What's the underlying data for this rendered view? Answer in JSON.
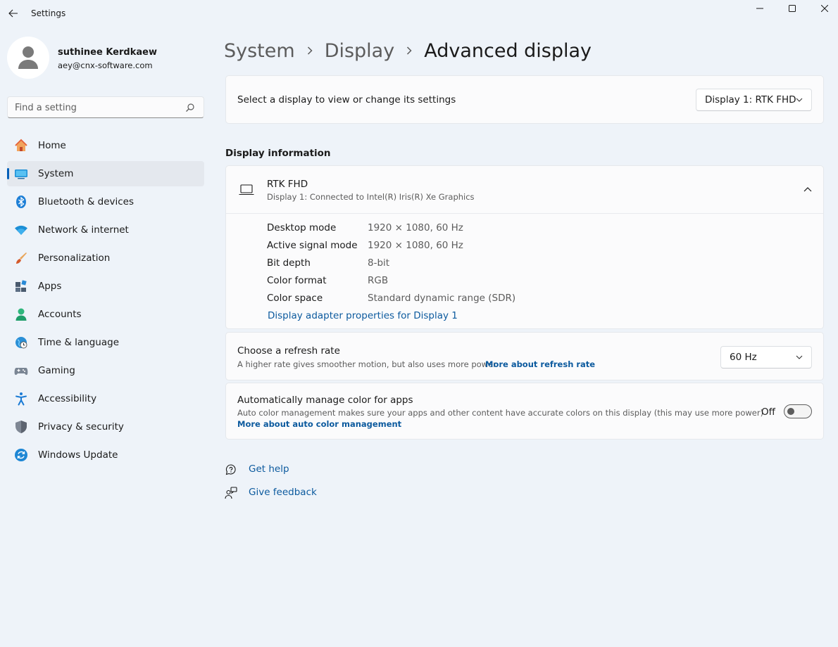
{
  "window": {
    "title": "Settings"
  },
  "profile": {
    "name": "suthinee Kerdkaew",
    "email": "aey@cnx-software.com"
  },
  "search": {
    "placeholder": "Find a setting"
  },
  "sidebar": {
    "items": [
      {
        "label": "Home",
        "icon": "home-icon"
      },
      {
        "label": "System",
        "icon": "system-icon",
        "active": true
      },
      {
        "label": "Bluetooth & devices",
        "icon": "bluetooth-icon"
      },
      {
        "label": "Network & internet",
        "icon": "wifi-icon"
      },
      {
        "label": "Personalization",
        "icon": "brush-icon"
      },
      {
        "label": "Apps",
        "icon": "apps-icon"
      },
      {
        "label": "Accounts",
        "icon": "accounts-icon"
      },
      {
        "label": "Time & language",
        "icon": "globe-clock-icon"
      },
      {
        "label": "Gaming",
        "icon": "gamepad-icon"
      },
      {
        "label": "Accessibility",
        "icon": "accessibility-icon"
      },
      {
        "label": "Privacy & security",
        "icon": "shield-icon"
      },
      {
        "label": "Windows Update",
        "icon": "update-icon"
      }
    ]
  },
  "breadcrumb": {
    "items": [
      "System",
      "Display",
      "Advanced display"
    ]
  },
  "display_select": {
    "label": "Select a display to view or change its settings",
    "value": "Display 1: RTK FHD"
  },
  "display_info": {
    "section_title": "Display information",
    "name": "RTK FHD",
    "subtitle": "Display 1: Connected to Intel(R) Iris(R) Xe Graphics",
    "rows": [
      {
        "key": "Desktop mode",
        "value": "1920 × 1080, 60 Hz"
      },
      {
        "key": "Active signal mode",
        "value": "1920 × 1080, 60 Hz"
      },
      {
        "key": "Bit depth",
        "value": "8-bit"
      },
      {
        "key": "Color format",
        "value": "RGB"
      },
      {
        "key": "Color space",
        "value": "Standard dynamic range (SDR)"
      }
    ],
    "adapter_link": "Display adapter properties for Display 1"
  },
  "refresh_rate": {
    "title": "Choose a refresh rate",
    "description": "A higher rate gives smoother motion, but also uses more power",
    "link": "More about refresh rate",
    "value": "60 Hz"
  },
  "auto_color": {
    "title": "Automatically manage color for apps",
    "description": "Auto color management makes sure your apps and other content have accurate colors on this display (this may use more power)",
    "link": "More about auto color management",
    "toggle_label": "Off",
    "toggle_on": false
  },
  "help": {
    "get_help": "Get help",
    "give_feedback": "Give feedback"
  },
  "colors": {
    "accent": "#005fb8",
    "link": "#0c5a9e",
    "background": "#eef3f9",
    "card": "#fbfbfc"
  }
}
